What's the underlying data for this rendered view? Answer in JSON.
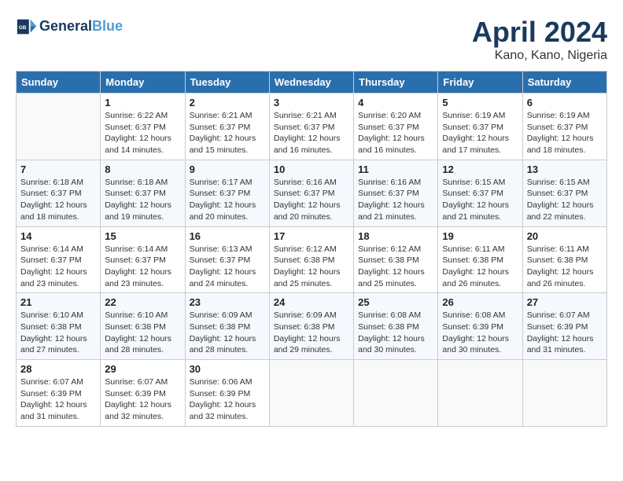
{
  "header": {
    "logo_line1": "General",
    "logo_line2": "Blue",
    "month_title": "April 2024",
    "location": "Kano, Kano, Nigeria"
  },
  "days_of_week": [
    "Sunday",
    "Monday",
    "Tuesday",
    "Wednesday",
    "Thursday",
    "Friday",
    "Saturday"
  ],
  "weeks": [
    [
      {
        "day": "",
        "info": ""
      },
      {
        "day": "1",
        "info": "Sunrise: 6:22 AM\nSunset: 6:37 PM\nDaylight: 12 hours\nand 14 minutes."
      },
      {
        "day": "2",
        "info": "Sunrise: 6:21 AM\nSunset: 6:37 PM\nDaylight: 12 hours\nand 15 minutes."
      },
      {
        "day": "3",
        "info": "Sunrise: 6:21 AM\nSunset: 6:37 PM\nDaylight: 12 hours\nand 16 minutes."
      },
      {
        "day": "4",
        "info": "Sunrise: 6:20 AM\nSunset: 6:37 PM\nDaylight: 12 hours\nand 16 minutes."
      },
      {
        "day": "5",
        "info": "Sunrise: 6:19 AM\nSunset: 6:37 PM\nDaylight: 12 hours\nand 17 minutes."
      },
      {
        "day": "6",
        "info": "Sunrise: 6:19 AM\nSunset: 6:37 PM\nDaylight: 12 hours\nand 18 minutes."
      }
    ],
    [
      {
        "day": "7",
        "info": "Sunrise: 6:18 AM\nSunset: 6:37 PM\nDaylight: 12 hours\nand 18 minutes."
      },
      {
        "day": "8",
        "info": "Sunrise: 6:18 AM\nSunset: 6:37 PM\nDaylight: 12 hours\nand 19 minutes."
      },
      {
        "day": "9",
        "info": "Sunrise: 6:17 AM\nSunset: 6:37 PM\nDaylight: 12 hours\nand 20 minutes."
      },
      {
        "day": "10",
        "info": "Sunrise: 6:16 AM\nSunset: 6:37 PM\nDaylight: 12 hours\nand 20 minutes."
      },
      {
        "day": "11",
        "info": "Sunrise: 6:16 AM\nSunset: 6:37 PM\nDaylight: 12 hours\nand 21 minutes."
      },
      {
        "day": "12",
        "info": "Sunrise: 6:15 AM\nSunset: 6:37 PM\nDaylight: 12 hours\nand 21 minutes."
      },
      {
        "day": "13",
        "info": "Sunrise: 6:15 AM\nSunset: 6:37 PM\nDaylight: 12 hours\nand 22 minutes."
      }
    ],
    [
      {
        "day": "14",
        "info": "Sunrise: 6:14 AM\nSunset: 6:37 PM\nDaylight: 12 hours\nand 23 minutes."
      },
      {
        "day": "15",
        "info": "Sunrise: 6:14 AM\nSunset: 6:37 PM\nDaylight: 12 hours\nand 23 minutes."
      },
      {
        "day": "16",
        "info": "Sunrise: 6:13 AM\nSunset: 6:37 PM\nDaylight: 12 hours\nand 24 minutes."
      },
      {
        "day": "17",
        "info": "Sunrise: 6:12 AM\nSunset: 6:38 PM\nDaylight: 12 hours\nand 25 minutes."
      },
      {
        "day": "18",
        "info": "Sunrise: 6:12 AM\nSunset: 6:38 PM\nDaylight: 12 hours\nand 25 minutes."
      },
      {
        "day": "19",
        "info": "Sunrise: 6:11 AM\nSunset: 6:38 PM\nDaylight: 12 hours\nand 26 minutes."
      },
      {
        "day": "20",
        "info": "Sunrise: 6:11 AM\nSunset: 6:38 PM\nDaylight: 12 hours\nand 26 minutes."
      }
    ],
    [
      {
        "day": "21",
        "info": "Sunrise: 6:10 AM\nSunset: 6:38 PM\nDaylight: 12 hours\nand 27 minutes."
      },
      {
        "day": "22",
        "info": "Sunrise: 6:10 AM\nSunset: 6:38 PM\nDaylight: 12 hours\nand 28 minutes."
      },
      {
        "day": "23",
        "info": "Sunrise: 6:09 AM\nSunset: 6:38 PM\nDaylight: 12 hours\nand 28 minutes."
      },
      {
        "day": "24",
        "info": "Sunrise: 6:09 AM\nSunset: 6:38 PM\nDaylight: 12 hours\nand 29 minutes."
      },
      {
        "day": "25",
        "info": "Sunrise: 6:08 AM\nSunset: 6:38 PM\nDaylight: 12 hours\nand 30 minutes."
      },
      {
        "day": "26",
        "info": "Sunrise: 6:08 AM\nSunset: 6:39 PM\nDaylight: 12 hours\nand 30 minutes."
      },
      {
        "day": "27",
        "info": "Sunrise: 6:07 AM\nSunset: 6:39 PM\nDaylight: 12 hours\nand 31 minutes."
      }
    ],
    [
      {
        "day": "28",
        "info": "Sunrise: 6:07 AM\nSunset: 6:39 PM\nDaylight: 12 hours\nand 31 minutes."
      },
      {
        "day": "29",
        "info": "Sunrise: 6:07 AM\nSunset: 6:39 PM\nDaylight: 12 hours\nand 32 minutes."
      },
      {
        "day": "30",
        "info": "Sunrise: 6:06 AM\nSunset: 6:39 PM\nDaylight: 12 hours\nand 32 minutes."
      },
      {
        "day": "",
        "info": ""
      },
      {
        "day": "",
        "info": ""
      },
      {
        "day": "",
        "info": ""
      },
      {
        "day": "",
        "info": ""
      }
    ]
  ]
}
